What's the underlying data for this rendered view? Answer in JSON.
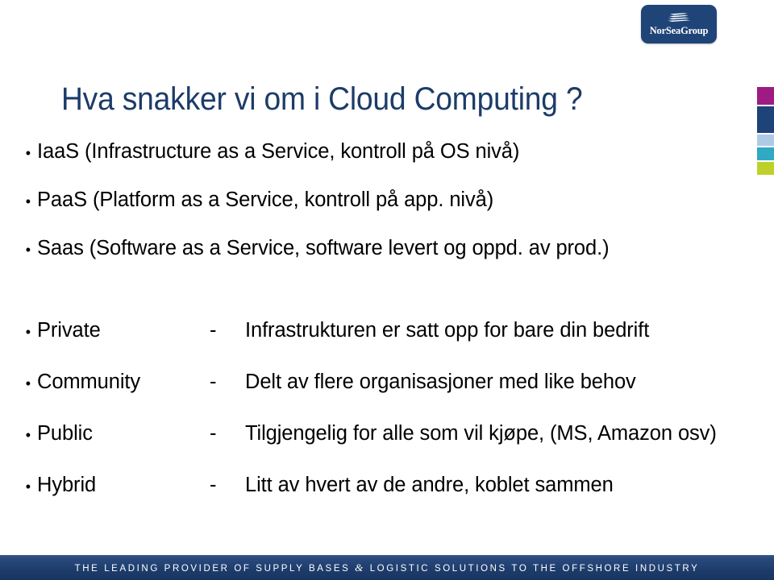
{
  "slide": {
    "title": "Hva snakker vi om i Cloud Computing ?",
    "title_color": "#1c3c68",
    "background_color": "#ffffff"
  },
  "logo": {
    "name": "NorSeaGroup",
    "mark": "wave-stripes-icon",
    "background_color": "#1f4578",
    "text_color": "#ffffff"
  },
  "swatches": [
    {
      "name": "magenta",
      "color": "#9e1b84"
    },
    {
      "name": "navy",
      "color": "#1d4379"
    },
    {
      "name": "light-blue",
      "color": "#aecbe6"
    },
    {
      "name": "teal",
      "color": "#2fa9c4"
    },
    {
      "name": "lime",
      "color": "#bed12a"
    }
  ],
  "service_models": {
    "bullet_glyph": "•",
    "items": [
      {
        "text": "IaaS   (Infrastructure as a Service, kontroll på OS nivå)"
      },
      {
        "text": "PaaS  (Platform as a Service, kontroll på app. nivå)"
      },
      {
        "text": "Saas  (Software as a Service, software levert og oppd. av prod.)"
      }
    ]
  },
  "deployment_models": {
    "bullet_glyph": "•",
    "separator": "-",
    "items": [
      {
        "term": "Private",
        "description": "Infrastrukturen er satt opp for bare din bedrift"
      },
      {
        "term": "Community",
        "description": "Delt av flere organisasjoner med like behov"
      },
      {
        "term": "Public",
        "description": "Tilgjengelig for alle som vil kjøpe, (MS, Amazon osv)"
      },
      {
        "term": "Hybrid",
        "description": "Litt av hvert av de andre, koblet sammen"
      }
    ]
  },
  "footer": {
    "part1": "THE LEADING PROVIDER OF SUPPLY BASES",
    "ampersand": "&",
    "part2": "LOGISTIC SOLUTIONS TO THE OFFSHORE INDUSTRY",
    "background_color": "#1d3c6b",
    "text_color": "#ffffff"
  }
}
